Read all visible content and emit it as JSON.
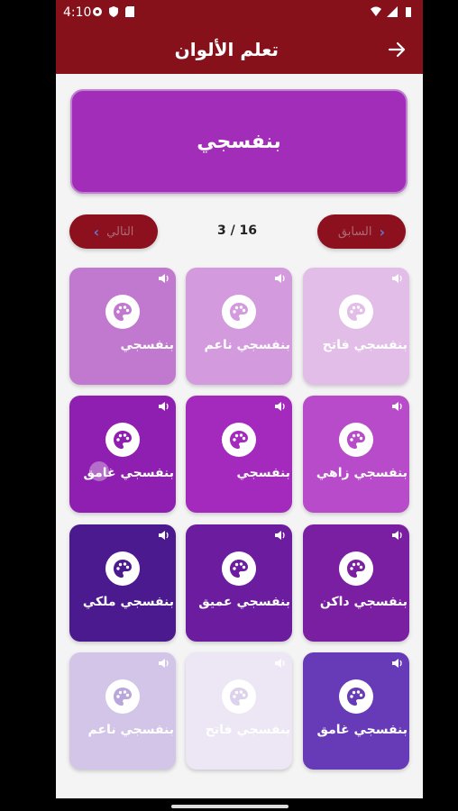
{
  "status_bar": {
    "time": "4:10"
  },
  "app_bar": {
    "title": "تعلم الألوان",
    "back_icon": "arrow-right-icon"
  },
  "banner": {
    "color_name": "بنفسجي",
    "color": "#a22db9"
  },
  "navigation": {
    "next_label": "التالي",
    "prev_label": "السابق",
    "counter": "3 / 16"
  },
  "grid": [
    {
      "name": "بنفسجي",
      "bg": "#c179d0",
      "icon_color": "#c179d0"
    },
    {
      "name": "بنفسجي ناعم",
      "bg": "#d39bde",
      "icon_color": "#d39bde"
    },
    {
      "name": "بنفسجي فاتح",
      "bg": "#e2bde8",
      "icon_color": "#e2bde8"
    },
    {
      "name": "بنفسجي غامق",
      "bg": "#8e1fb0",
      "icon_color": "#8e1fb0"
    },
    {
      "name": "بنفسجي",
      "bg": "#a429bd",
      "icon_color": "#a429bd"
    },
    {
      "name": "بنفسجي زاهي",
      "bg": "#b84bc9",
      "icon_color": "#b84bc9"
    },
    {
      "name": "بنفسجي ملكي",
      "bg": "#4b1a8f",
      "icon_color": "#4b1a8f"
    },
    {
      "name": "بنفسجي عميق",
      "bg": "#6b1c9f",
      "icon_color": "#6b1c9f"
    },
    {
      "name": "بنفسجي داكن",
      "bg": "#7b1fa2",
      "icon_color": "#7b1fa2"
    },
    {
      "name": "بنفسجي ناعم",
      "bg": "#d2c5e8",
      "icon_color": "#b9a6dc"
    },
    {
      "name": "بنفسجي فاتح",
      "bg": "#ece6f5",
      "icon_color": "#ddd2ec"
    },
    {
      "name": "بنفسجي غامق",
      "bg": "#673ab7",
      "icon_color": "#673ab7"
    }
  ]
}
